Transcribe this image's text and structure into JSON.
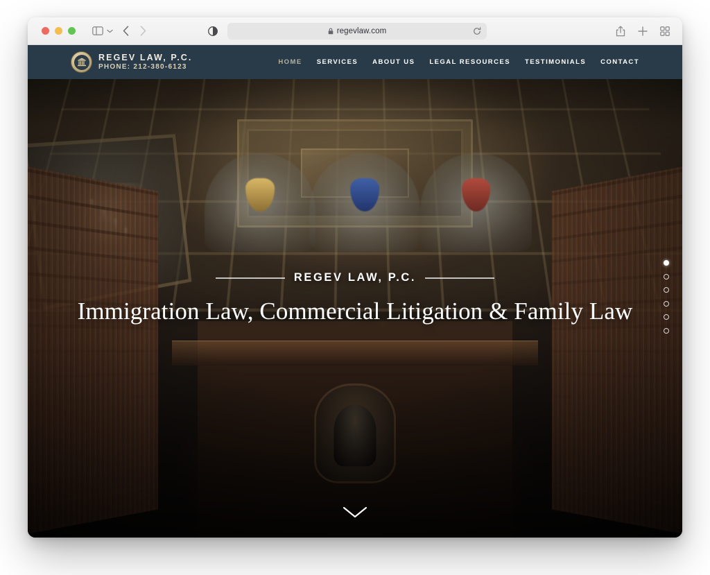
{
  "browser": {
    "url": "regevlaw.com",
    "lock_icon": "lock-icon",
    "reload_icon": "reload-icon",
    "traffic_lights": [
      "close",
      "minimize",
      "zoom"
    ],
    "toolbar_left_icons": [
      "sidebar-toggle-icon",
      "chevron-down-icon",
      "back-arrow-icon",
      "forward-arrow-icon"
    ],
    "reader_icon": "reader-contrast-icon",
    "toolbar_right_icons": [
      "share-icon",
      "new-tab-icon",
      "tab-overview-icon"
    ]
  },
  "site": {
    "header": {
      "brand_name": "REGEV LAW, P.C.",
      "brand_phone": "PHONE: 212-380-6123",
      "seal_icon": "courthouse-seal-icon",
      "background_color": "#293b49",
      "nav": [
        {
          "label": "HOME",
          "active": false,
          "muted": true
        },
        {
          "label": "SERVICES",
          "active": true,
          "muted": false
        },
        {
          "label": "ABOUT US",
          "active": false,
          "muted": false
        },
        {
          "label": "LEGAL RESOURCES",
          "active": false,
          "muted": false
        },
        {
          "label": "TESTIMONIALS",
          "active": false,
          "muted": false
        },
        {
          "label": "CONTACT",
          "active": false,
          "muted": false
        }
      ]
    },
    "hero": {
      "eyebrow": "REGEV LAW, P.C.",
      "heading": "Immigration Law, Commercial Litigation & Family Law",
      "image_description": "ornate historic law library with coffered gilded ceiling, chandelier and floor-to-ceiling bookshelves",
      "scroll_icon": "chevron-down-icon",
      "slides": [
        {
          "index": 1,
          "active": true
        },
        {
          "index": 2,
          "active": false
        },
        {
          "index": 3,
          "active": false
        },
        {
          "index": 4,
          "active": false
        },
        {
          "index": 5,
          "active": false
        },
        {
          "index": 6,
          "active": false
        }
      ]
    }
  }
}
